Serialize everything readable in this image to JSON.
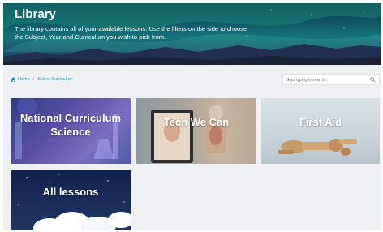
{
  "header": {
    "title": "Library",
    "description": "The library contains all of your available lessons. Use the filters on the side to choose the Subject, Year and Curriculum you wish to pick from."
  },
  "breadcrumb": {
    "home_icon": "home-icon",
    "home_label": "Home",
    "separator": "/",
    "current_label": "Select Curriculum"
  },
  "search": {
    "placeholder": "Start typing to search...",
    "icon": "search-icon"
  },
  "tiles": [
    {
      "label": "National Curriculum Science"
    },
    {
      "label": "Tech We Can"
    },
    {
      "label": "First Aid"
    },
    {
      "label": "All lessons"
    }
  ]
}
